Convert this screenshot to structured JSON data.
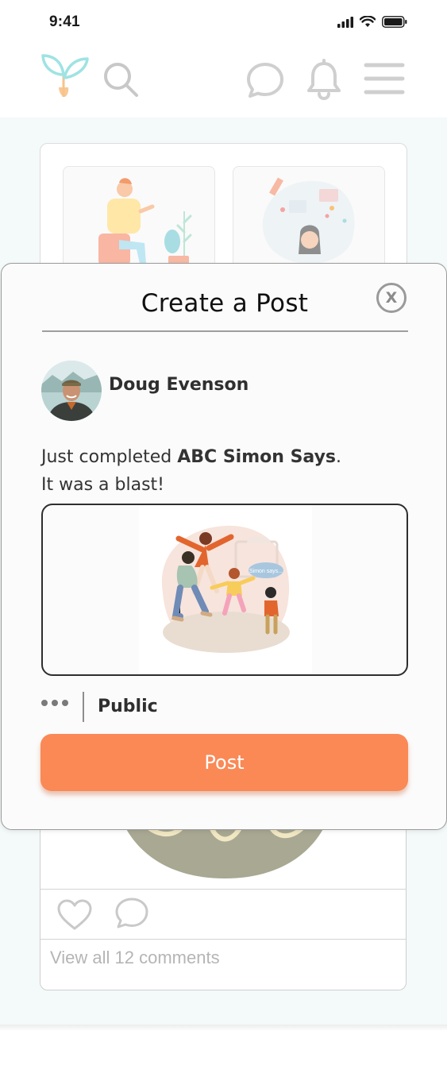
{
  "status_bar": {
    "time": "9:41"
  },
  "header": {
    "logo_icon": "sprout-logo-icon",
    "search_icon": "search-icon",
    "chat_icon": "chat-bubble-icon",
    "notification_icon": "bell-icon",
    "menu_icon": "hamburger-menu-icon"
  },
  "background_post": {
    "comments_link": "View all 12 comments"
  },
  "modal": {
    "title": "Create a Post",
    "close_label": "X",
    "user": {
      "name": "Doug Evenson"
    },
    "post_text": {
      "prefix": "Just completed ",
      "activity": "ABC Simon Says",
      "suffix": ".",
      "line2": "It was a blast!"
    },
    "image": {
      "bubble_text": "Simon says..."
    },
    "visibility": "Public",
    "post_button": "Post"
  },
  "colors": {
    "accent": "#fa8956",
    "feed_background": "#f4f9f9",
    "logo_teal": "#9fe3e3",
    "logo_orange": "#f7c38a"
  }
}
